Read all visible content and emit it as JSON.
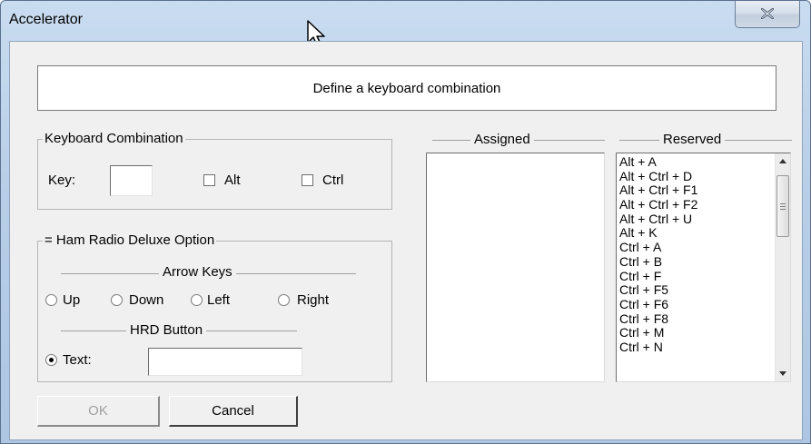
{
  "window": {
    "title": "Accelerator"
  },
  "banner": {
    "text": "Define a keyboard combination"
  },
  "keyboard_combination": {
    "group_label": "Keyboard Combination",
    "key_label": "Key:",
    "key_value": "",
    "alt_label": "Alt",
    "alt_checked": false,
    "ctrl_label": "Ctrl",
    "ctrl_checked": false
  },
  "hrd_option": {
    "group_label": "= Ham Radio Deluxe Option",
    "arrow_keys_label": "Arrow Keys",
    "arrows": [
      {
        "label": "Up",
        "checked": false
      },
      {
        "label": "Down",
        "checked": false
      },
      {
        "label": "Left",
        "checked": false
      },
      {
        "label": "Right",
        "checked": false
      }
    ],
    "hrd_button_label": "HRD Button",
    "text_label": "Text:",
    "text_checked": true,
    "text_value": ""
  },
  "assigned": {
    "header": "Assigned",
    "items": []
  },
  "reserved": {
    "header": "Reserved",
    "items": [
      "Alt + A",
      "Alt + Ctrl + D",
      "Alt + Ctrl + F1",
      "Alt + Ctrl + F2",
      "Alt + Ctrl + U",
      "Alt + K",
      "Ctrl + A",
      "Ctrl + B",
      "Ctrl + F",
      "Ctrl + F5",
      "Ctrl + F6",
      "Ctrl + F8",
      "Ctrl + M",
      "Ctrl + N"
    ]
  },
  "buttons": {
    "ok_label": "OK",
    "ok_enabled": false,
    "cancel_label": "Cancel"
  }
}
